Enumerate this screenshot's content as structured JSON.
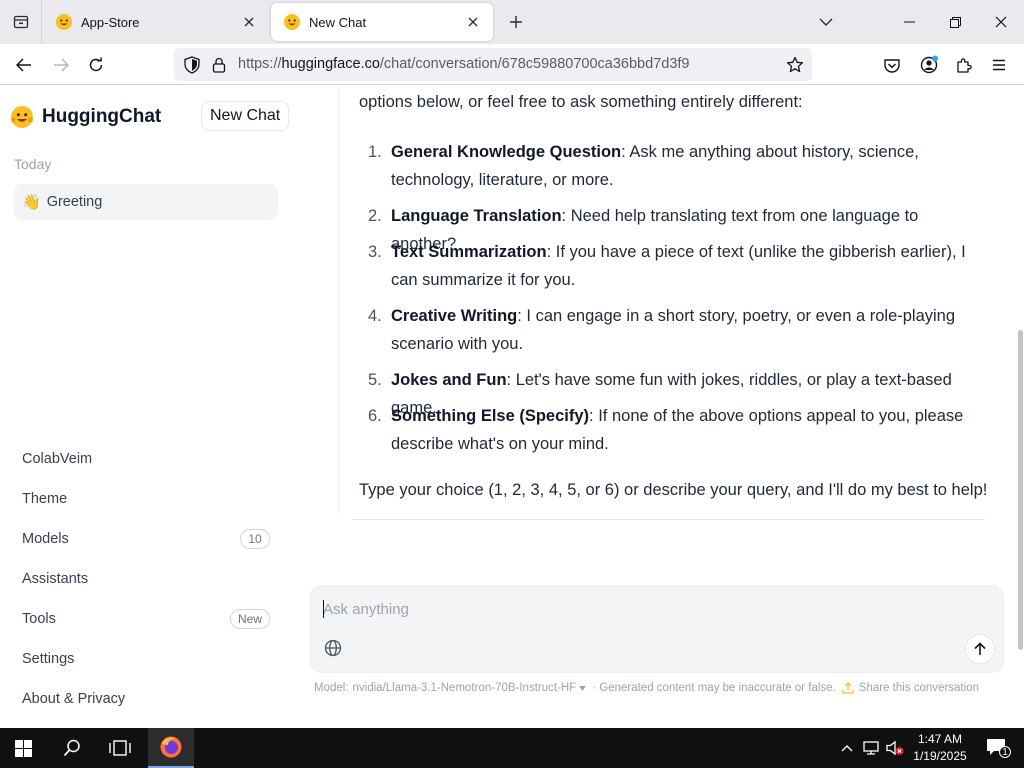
{
  "browser": {
    "tabs": [
      {
        "title": "App-Store",
        "active": false
      },
      {
        "title": "New Chat",
        "active": true
      }
    ],
    "url": {
      "prefix": "https://",
      "domain": "huggingface.co",
      "path": "/chat/conversation/678c59880700ca36bbd7d3f9"
    }
  },
  "sidebar": {
    "brand": "HuggingChat",
    "new_chat_label": "New Chat",
    "section_today": "Today",
    "conversations": [
      {
        "emoji": "👋",
        "title": "Greeting"
      }
    ],
    "links": [
      {
        "label": "ColabVeim"
      },
      {
        "label": "Theme"
      },
      {
        "label": "Models",
        "badge": "10"
      },
      {
        "label": "Assistants"
      },
      {
        "label": "Tools",
        "badge": "New"
      },
      {
        "label": "Settings"
      },
      {
        "label": "About & Privacy"
      }
    ]
  },
  "message": {
    "intro": "options below, or feel free to ask something entirely different:",
    "options": [
      {
        "num": "1.",
        "bold": "General Knowledge Question",
        "text": ": Ask me anything about history, science, technology, literature, or more."
      },
      {
        "num": "2.",
        "bold": "Language Translation",
        "text": ": Need help translating text from one language to another?"
      },
      {
        "num": "3.",
        "bold": "Text Summarization",
        "text": ": If you have a piece of text (unlike the gibberish earlier), I can summarize it for you."
      },
      {
        "num": "4.",
        "bold": "Creative Writing",
        "text": ": I can engage in a short story, poetry, or even a role-playing scenario with you."
      },
      {
        "num": "5.",
        "bold": "Jokes and Fun",
        "text": ": Let's have some fun with jokes, riddles, or play a text-based game."
      },
      {
        "num": "6.",
        "bold": "Something Else (Specify)",
        "text": ": If none of the above options appeal to you, please describe what's on your mind."
      }
    ],
    "outro": "Type your choice (1, 2, 3, 4, 5, or 6) or describe your query, and I'll do my best to help!"
  },
  "composer": {
    "placeholder": "Ask anything"
  },
  "footer": {
    "model_label": "Model:",
    "model_name": "nvidia/Llama-3.1-Nemotron-70B-Instruct-HF",
    "disclaimer": "· Generated content may be inaccurate or false.",
    "share_label": "Share this conversation"
  },
  "taskbar": {
    "time": "1:47 AM",
    "date": "1/19/2025",
    "notification_count": "1"
  },
  "colors": {
    "accent": "#fbbf24",
    "firefox_orange": "#ff7139",
    "firefox_purple": "#6f3bd6"
  }
}
